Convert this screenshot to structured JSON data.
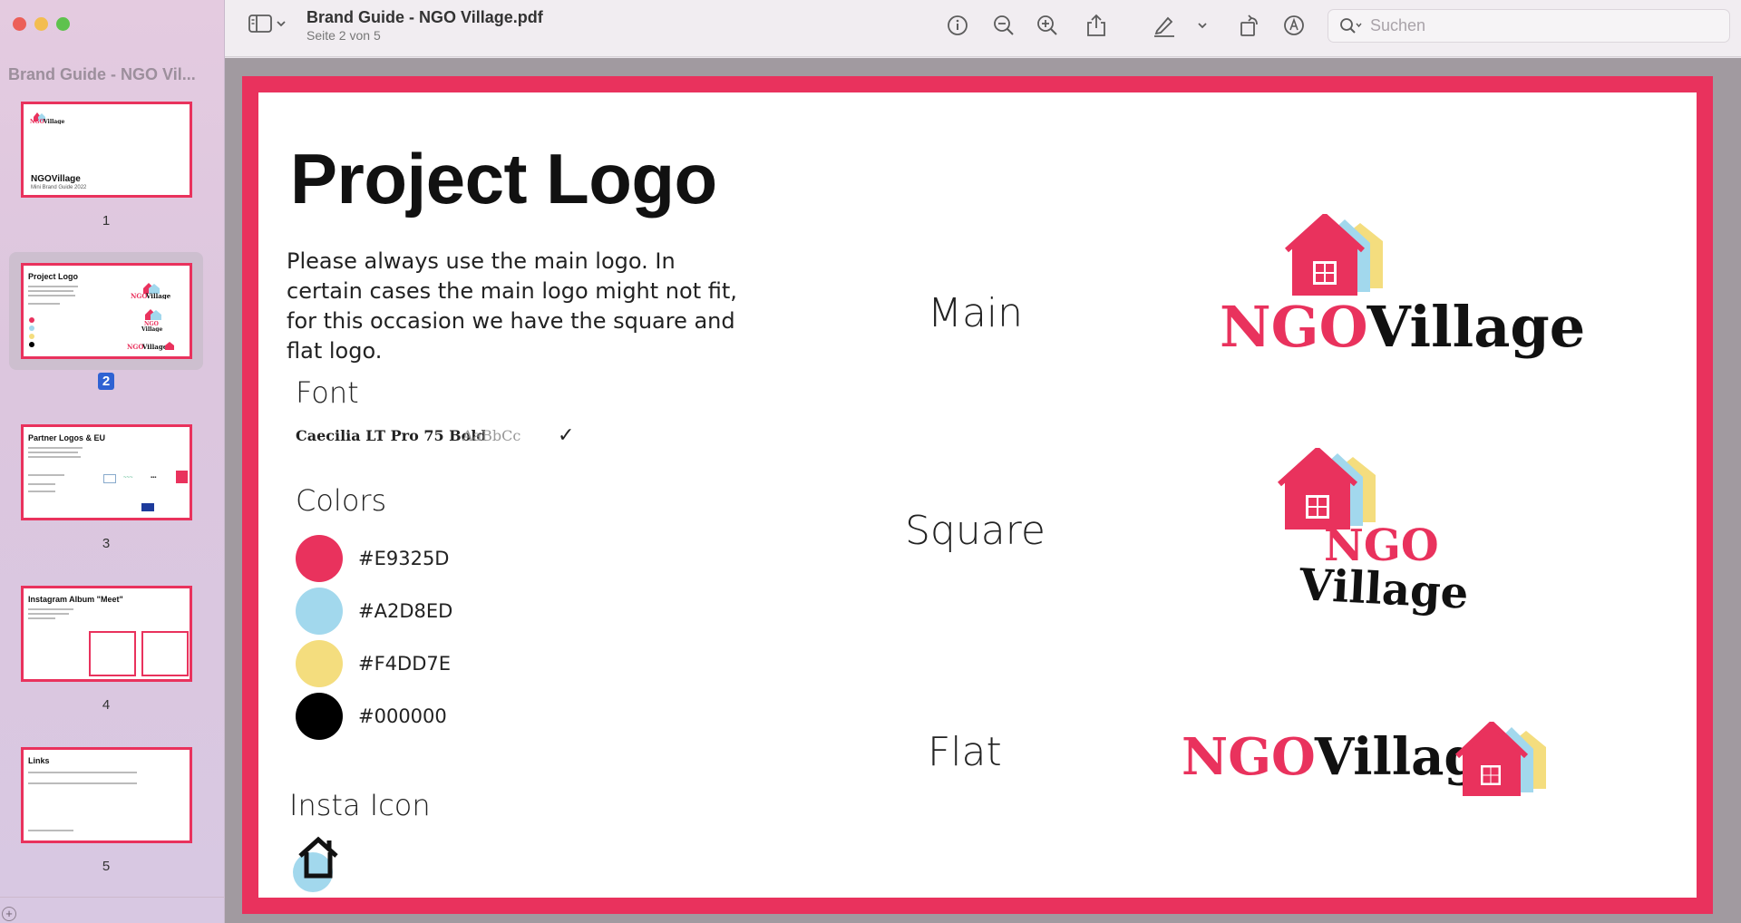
{
  "sidebar": {
    "title": "Brand Guide - NGO Vil...",
    "pages": [
      {
        "num": "1",
        "title": "NGOVillage",
        "subtitle": "Mini Brand Guide 2022"
      },
      {
        "num": "2",
        "title": "Project Logo"
      },
      {
        "num": "3",
        "title": "Partner Logos & EU"
      },
      {
        "num": "4",
        "title": "Instagram Album \"Meet\""
      },
      {
        "num": "5",
        "title": "Links"
      }
    ]
  },
  "toolbar": {
    "doc_title": "Brand Guide - NGO Village.pdf",
    "page_indicator": "Seite 2 von 5",
    "search_placeholder": "Suchen"
  },
  "document": {
    "heading": "Project Logo",
    "intro": "Please always use the main logo. In certain cases the main logo might not fit, for this occasion we have the square and flat logo.",
    "font_heading": "Font",
    "font_name": "Caecilia LT Pro 75 Bold",
    "font_sample": "AaBbCc",
    "colors_heading": "Colors",
    "colors": [
      {
        "hex": "#E9325D",
        "swatch": "#e9325d"
      },
      {
        "hex": "#A2D8ED",
        "swatch": "#a2d8ed"
      },
      {
        "hex": "#F4DD7E",
        "swatch": "#f4dd7e"
      },
      {
        "hex": "#000000",
        "swatch": "#000000"
      }
    ],
    "insta_heading": "Insta Icon",
    "variants": {
      "main": "Main",
      "square": "Square",
      "flat": "Flat"
    },
    "logo": {
      "ngo": "NGO",
      "village": "Village"
    }
  },
  "colors": {
    "brand_red": "#e9325d",
    "brand_blue": "#a2d8ed",
    "brand_yellow": "#f4dd7e"
  }
}
